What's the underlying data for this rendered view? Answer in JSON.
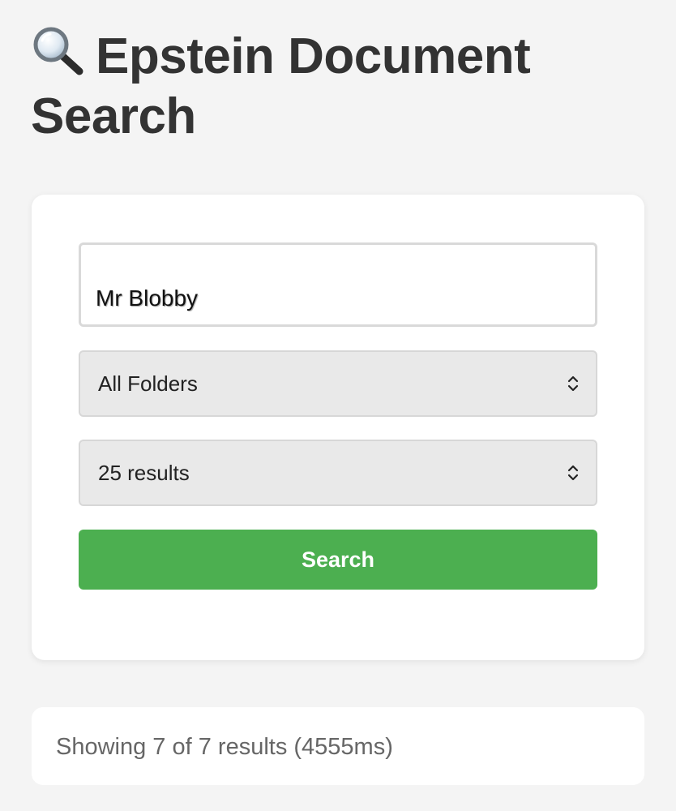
{
  "header": {
    "title": "Epstein Document Search",
    "icon": "magnifying-glass-icon"
  },
  "search_form": {
    "query_value": "Mr Blobby",
    "folder_select": {
      "selected": "All Folders",
      "icon": "chevron-up-down-icon"
    },
    "result_count_select": {
      "selected": "25 results",
      "icon": "chevron-up-down-icon"
    },
    "search_button_label": "Search"
  },
  "results_status": {
    "text": "Showing 7 of 7 results (4555ms)"
  },
  "colors": {
    "page_background": "#f4f4f4",
    "card_background": "#ffffff",
    "button_green": "#4caf50",
    "select_background": "#e9e9e9",
    "title_text": "#333333",
    "status_text": "#666666"
  }
}
